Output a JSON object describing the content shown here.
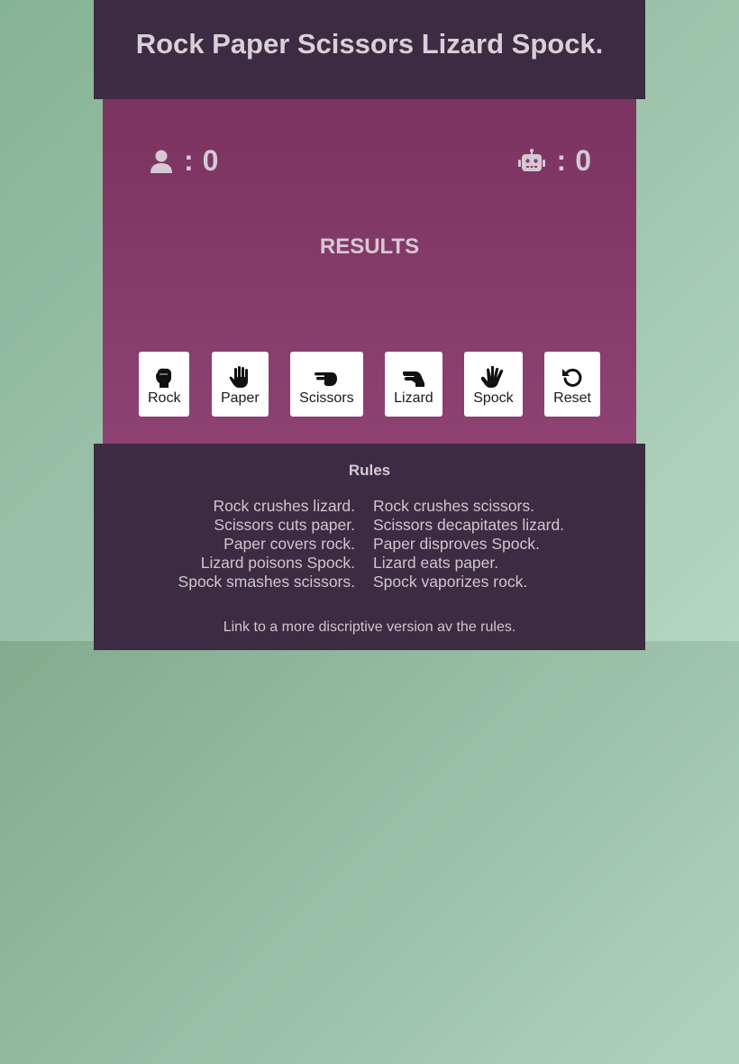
{
  "title": "Rock Paper Scissors Lizard Spock.",
  "scoreboard": {
    "player": {
      "icon": "user-icon",
      "separator": ":",
      "score": "0"
    },
    "computer": {
      "icon": "robot-icon",
      "separator": ":",
      "score": "0"
    }
  },
  "results_label": "RESULTS",
  "buttons": [
    {
      "label": "Rock",
      "icon": "hand-rock-icon"
    },
    {
      "label": "Paper",
      "icon": "hand-paper-icon"
    },
    {
      "label": "Scissors",
      "icon": "hand-scissors-icon"
    },
    {
      "label": "Lizard",
      "icon": "hand-lizard-icon"
    },
    {
      "label": "Spock",
      "icon": "hand-spock-icon"
    },
    {
      "label": "Reset",
      "icon": "undo-icon"
    }
  ],
  "rules": {
    "heading": "Rules",
    "left": [
      "Rock crushes lizard.",
      "Scissors cuts paper.",
      "Paper covers rock.",
      "Lizard poisons Spock.",
      "Spock smashes scissors."
    ],
    "right": [
      "Rock crushes scissors.",
      "Scissors decapitates lizard.",
      "Paper disproves Spock.",
      "Lizard eats paper.",
      "Spock vaporizes rock."
    ],
    "link_text": "Link to a more discriptive version av the rules."
  },
  "colors": {
    "header_bg": "#3c2b43",
    "game_bg": "#8e4273",
    "page_bg": "#8fb59a",
    "button_bg": "#ffffff"
  }
}
